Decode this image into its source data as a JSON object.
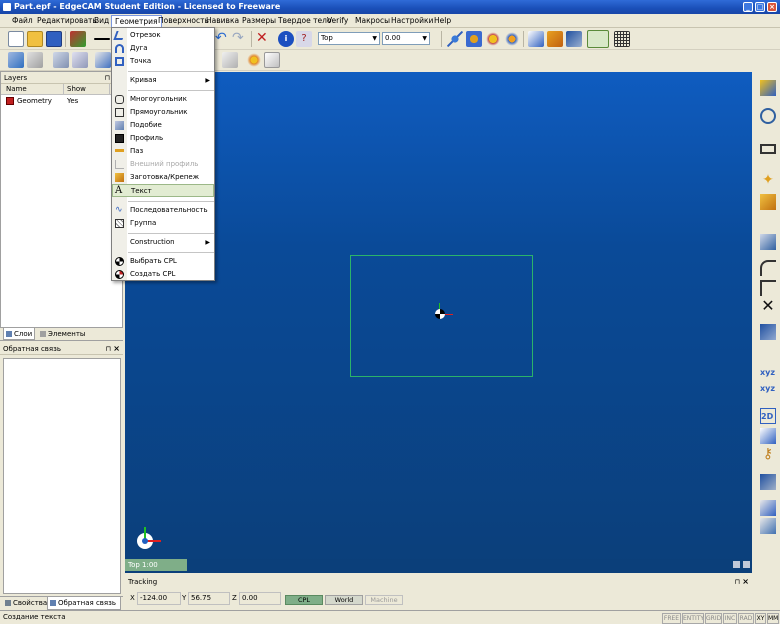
{
  "window": {
    "title": "Part.epf - EdgeCAM Student Edition - Licensed to Freeware"
  },
  "menubar": {
    "items": [
      "Файл",
      "Редактировать",
      "Вид",
      "Геометрия",
      "Поверхность",
      "Навивка",
      "Размеры",
      "Твердое тело",
      "Verify",
      "Макросы",
      "Настройки",
      "Help"
    ]
  },
  "toolbar": {
    "view_select": "Top",
    "value_field": "0.00"
  },
  "geometry_menu": {
    "items": [
      {
        "label": "Отрезок",
        "icon": "line-icon"
      },
      {
        "label": "Дуга",
        "icon": "arc-icon"
      },
      {
        "label": "Точка",
        "icon": "point-icon"
      },
      {
        "label": "Кривая",
        "icon": "",
        "submenu": true
      },
      {
        "label": "Многоугольник",
        "icon": "polygon-icon"
      },
      {
        "label": "Прямоугольник",
        "icon": "rectangle-icon"
      },
      {
        "label": "Подобие",
        "icon": "similar-icon"
      },
      {
        "label": "Профиль",
        "icon": "profile-icon"
      },
      {
        "label": "Паз",
        "icon": "slot-icon"
      },
      {
        "label": "Внешний профиль",
        "icon": "outer-profile-icon",
        "disabled": true
      },
      {
        "label": "Заготовка/Крепеж",
        "icon": "stock-fixture-icon"
      },
      {
        "label": "Текст",
        "icon": "text-icon",
        "hover": true
      },
      {
        "label": "Последовательность",
        "icon": "sequence-icon"
      },
      {
        "label": "Группа",
        "icon": "group-icon"
      },
      {
        "label": "Construction",
        "icon": "",
        "submenu": true
      },
      {
        "label": "Выбрать CPL",
        "icon": "select-cpl-icon"
      },
      {
        "label": "Создать CPL",
        "icon": "create-cpl-icon"
      }
    ]
  },
  "layers_panel": {
    "title": "Layers",
    "columns": [
      "Name",
      "Show"
    ],
    "rows": [
      {
        "name": "Geometry",
        "show": "Yes"
      }
    ],
    "tabs": [
      "Слои",
      "Элементы"
    ]
  },
  "feedback_panel": {
    "title": "Обратная связь",
    "tabs": [
      "Свойства",
      "Обратная связь"
    ]
  },
  "viewport": {
    "label": "Top 1:00",
    "background_top": "#0f5cc0",
    "background_bottom": "#0b3f7a",
    "stock_color": "#2bb36a"
  },
  "tracking": {
    "title": "Tracking",
    "x_label": "X",
    "x_value": "-124.00",
    "y_label": "Y",
    "y_value": "56.75",
    "z_label": "Z",
    "z_value": "0.00",
    "buttons": [
      "CPL",
      "World",
      "Machine"
    ]
  },
  "statusbar": {
    "text": "Создание текста",
    "indicators": [
      "FREE",
      "ENTITY",
      "GRID",
      "INC",
      "RAD",
      "XY",
      "MM"
    ]
  }
}
